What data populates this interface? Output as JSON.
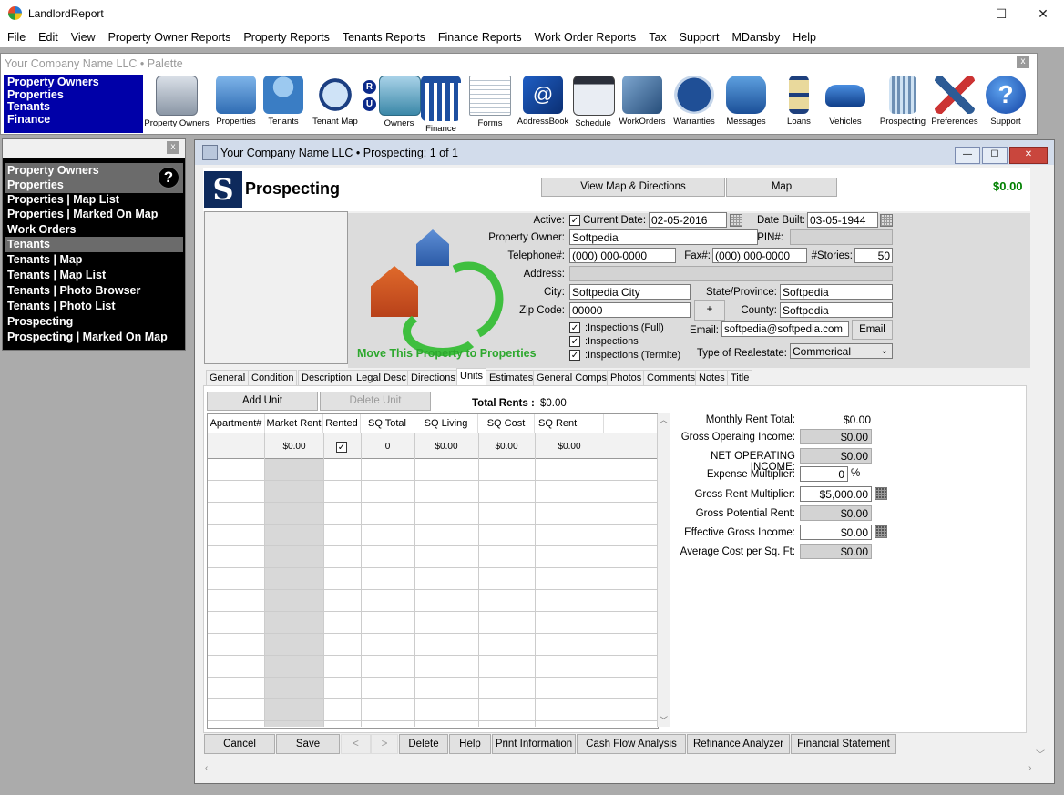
{
  "app": {
    "title": "LandlordReport"
  },
  "menu": [
    "File",
    "Edit",
    "View",
    "Property Owner Reports",
    "Property Reports",
    "Tenants Reports",
    "Finance Reports",
    "Work Order Reports",
    "Tax",
    "Support",
    "MDansby",
    "Help"
  ],
  "palette": {
    "title": "Your Company Name LLC  • Palette",
    "nav": [
      "Property Owners",
      "Properties",
      "Tenants",
      "Finance"
    ],
    "ru": [
      "R",
      "U"
    ],
    "tools": [
      {
        "label": "Property Owners",
        "icon": "building-icon"
      },
      {
        "label": "Properties",
        "icon": "house-icon"
      },
      {
        "label": "Tenants",
        "icon": "people-icon"
      },
      {
        "label": "Tenant Map",
        "icon": "magnifier-globe-icon"
      },
      {
        "label": "Owners",
        "icon": "storefront-icon"
      },
      {
        "label": "Finance",
        "icon": "bank-icon"
      },
      {
        "label": "Forms",
        "icon": "forms-icon"
      },
      {
        "label": "AddressBook",
        "icon": "addressbook-icon"
      },
      {
        "label": "Schedule",
        "icon": "schedule-icon"
      },
      {
        "label": "WorkOrders",
        "icon": "tools-icon"
      },
      {
        "label": "Warranties",
        "icon": "warranty-badge-icon"
      },
      {
        "label": "Messages",
        "icon": "phone-icon"
      },
      {
        "label": "Loans",
        "icon": "hourglass-icon"
      },
      {
        "label": "Vehicles",
        "icon": "car-icon"
      },
      {
        "label": "Prospecting",
        "icon": "tower-icon"
      },
      {
        "label": "Preferences",
        "icon": "wrench-screwdriver-icon"
      },
      {
        "label": "Support",
        "icon": "help-icon"
      }
    ],
    "colors": {
      "nav_bg": "#0000a8"
    }
  },
  "leftpane": {
    "items": [
      {
        "label": "Property Owners",
        "style": "grey"
      },
      {
        "label": "Properties",
        "style": "grey"
      },
      {
        "label": "Properties | Map List",
        "style": "black"
      },
      {
        "label": "Properties | Marked On Map",
        "style": "black"
      },
      {
        "label": "Work Orders",
        "style": "black"
      },
      {
        "label": "Tenants",
        "style": "grey"
      },
      {
        "label": "Tenants | Map",
        "style": "black"
      },
      {
        "label": "Tenants | Map List",
        "style": "black"
      },
      {
        "label": "Tenants | Photo Browser",
        "style": "black"
      },
      {
        "label": "Tenants | Photo List",
        "style": "black"
      },
      {
        "label": "Prospecting",
        "style": "black"
      },
      {
        "label": "Prospecting | Marked On Map",
        "style": "black"
      }
    ],
    "help_glyph": "?"
  },
  "child": {
    "title": "Your Company Name LLC  •  Prospecting: 1 of 1",
    "logo_letter": "S",
    "page_title": "Prospecting",
    "view_map_btn": "View Map & Directions",
    "map_btn": "Map",
    "total": "$0.00",
    "move_text": "Move This Property to Properties"
  },
  "form": {
    "active_label": "Active:",
    "active_checked": true,
    "current_date_label": "Current Date:",
    "current_date": "02-05-2016",
    "date_built_label": "Date Built:",
    "date_built": "03-05-1944",
    "owner_label": "Property Owner:",
    "owner": "Softpedia",
    "pin_label": "PIN#:",
    "pin": "",
    "tel_label": "Telephone#:",
    "tel": "(000) 000-0000",
    "fax_label": "Fax#:",
    "fax": "(000) 000-0000",
    "stories_label": "#Stories:",
    "stories": "50",
    "address_label": "Address:",
    "address": "",
    "city_label": "City:",
    "city": "Softpedia City",
    "state_label": "State/Province:",
    "state": "Softpedia",
    "zip_label": "Zip Code:",
    "zip": "00000",
    "plus": "+",
    "county_label": "County:",
    "county": "Softpedia",
    "inspections": [
      ":Inspections (Full)",
      ":Inspections",
      ":Inspections (Termite)"
    ],
    "email_label": "Email:",
    "email": "softpedia@softpedia.com",
    "email_btn": "Email",
    "type_label": "Type of Realestate:",
    "type": "Commerical"
  },
  "tabs": [
    "General",
    "Condition",
    "Description",
    "Legal Desc",
    "Directions",
    "Units",
    "Estimates",
    "General Comps",
    "Photos",
    "Comments",
    "Notes",
    "Title"
  ],
  "units": {
    "add_btn": "Add Unit",
    "delete_btn": "Delete Unit",
    "total_rents_label": "Total Rents :",
    "total_rents": "$0.00",
    "columns": [
      "Apartment#",
      "Market Rent",
      "Rented",
      "SQ Total",
      "SQ Living",
      "SQ Cost",
      "SQ Rent"
    ],
    "rows": [
      [
        "",
        "$0.00",
        "checked",
        "0",
        "$0.00",
        "$0.00",
        "$0.00"
      ]
    ]
  },
  "finance": [
    {
      "label": "Monthly Rent Total:",
      "value": "$0.00",
      "style": "plain"
    },
    {
      "label": "Gross Operaing Income:",
      "value": "$0.00",
      "style": "ro"
    },
    {
      "label": "NET OPERATING INCOME:",
      "value": "$0.00",
      "style": "ro"
    },
    {
      "label": "Expense Multiplier:",
      "value": "0",
      "style": "edit",
      "suffix": "%"
    },
    {
      "label": "Gross Rent Multiplier:",
      "value": "$5,000.00",
      "style": "edit",
      "calc": true
    },
    {
      "label": "Gross Potential Rent:",
      "value": "$0.00",
      "style": "ro"
    },
    {
      "label": "Effective Gross Income:",
      "value": "$0.00",
      "style": "edit",
      "calc": true
    },
    {
      "label": "Average Cost per Sq. Ft:",
      "value": "$0.00",
      "style": "ro"
    }
  ],
  "bottom_buttons": [
    "Cancel",
    "Save",
    "<",
    ">",
    "Delete",
    "Help",
    "Print Information",
    "Cash Flow Analysis",
    "Refinance Analyzer",
    "Financial Statement"
  ],
  "window_controls": {
    "min": "—",
    "max": "☐",
    "close": "✕"
  }
}
